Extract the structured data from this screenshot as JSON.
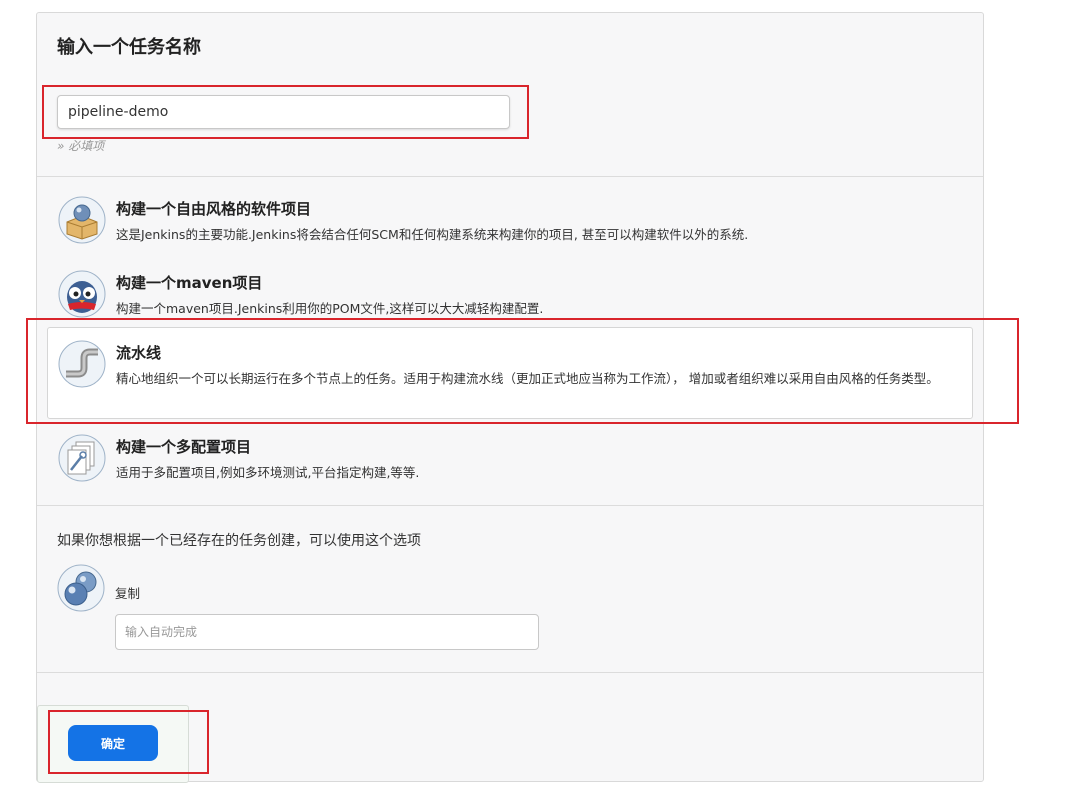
{
  "form": {
    "title": "输入一个任务名称",
    "name_value": "pipeline-demo",
    "required_hint": "» 必填项"
  },
  "job_types": [
    {
      "title": "构建一个自由风格的软件项目",
      "description": "这是Jenkins的主要功能.Jenkins将会结合任何SCM和任何构建系统来构建你的项目, 甚至可以构建软件以外的系统.",
      "icon": "freestyle-box-icon",
      "selected": false
    },
    {
      "title": "构建一个maven项目",
      "description": "构建一个maven项目.Jenkins利用你的POM文件,这样可以大大减轻构建配置.",
      "icon": "maven-owl-icon",
      "selected": false
    },
    {
      "title": "流水线",
      "description": "精心地组织一个可以长期运行在多个节点上的任务。适用于构建流水线（更加正式地应当称为工作流）， 增加或者组织难以采用自由风格的任务类型。",
      "icon": "pipeline-icon",
      "selected": true
    },
    {
      "title": "构建一个多配置项目",
      "description": "适用于多配置项目,例如多环境测试,平台指定构建,等等.",
      "icon": "multiconfig-icon",
      "selected": false
    }
  ],
  "copy": {
    "prompt": "如果你想根据一个已经存在的任务创建，可以使用这个选项",
    "label": "复制",
    "placeholder": "输入自动完成",
    "icon": "copy-spheres-icon"
  },
  "ok_label": "确定",
  "colors": {
    "primary": "#1473e6",
    "annotation": "#d9252c",
    "panel": "#f7f7f8"
  }
}
